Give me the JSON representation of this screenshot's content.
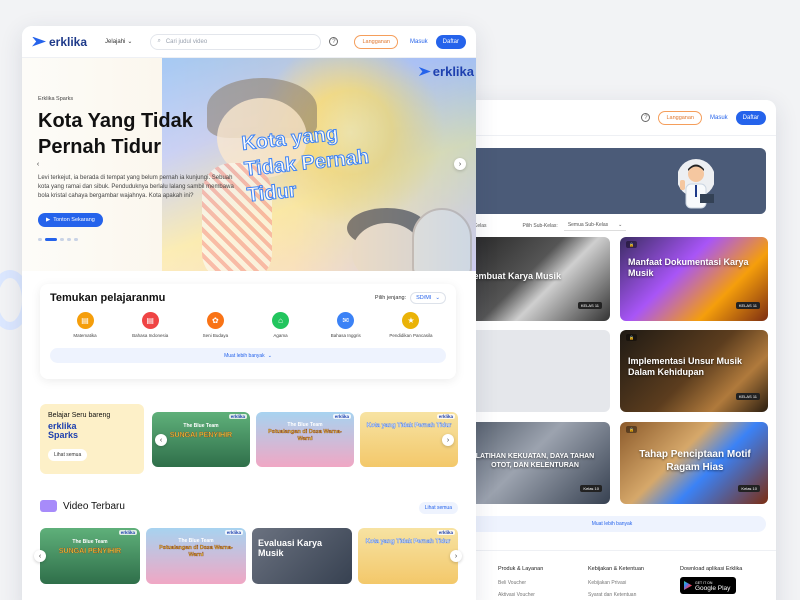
{
  "brand": "erklika",
  "back": {
    "nav": {
      "login": "Masuk",
      "register": "Daftar",
      "subscribe": "Langganan"
    },
    "filters": {
      "kelas": "Kelas",
      "subkelas_label": "Pilih Sub-Kelas:",
      "subkelas_value": "Semua Sub-Kelas"
    },
    "cards": [
      {
        "title": "Membuat Karya Musik",
        "kelas": "KELAS 11",
        "bg": "#3a3a3a"
      },
      {
        "title": "Manfaat Dokumentasi Karya Musik",
        "kelas": "KELAS 11",
        "bg": "#5b3a6e"
      },
      {
        "title": "",
        "kelas": "",
        "bg": "#e5e7eb"
      },
      {
        "title": "Implementasi Unsur Musik Dalam Kehidupan",
        "kelas": "KELAS 11",
        "bg": "#4a3320"
      },
      {
        "title": "LATIHAN KEKUATAN, DAYA TAHAN OTOT, DAN KELENTURAN",
        "kelas": "Kelas 10",
        "bg": "#3f4a5a"
      },
      {
        "title": "Tahap Penciptaan Motif Ragam Hias",
        "kelas": "Kelas 10",
        "bg": "#6b4a2e"
      }
    ],
    "more": "Muat lebih banyak",
    "footer": {
      "col1": {
        "title": "Produk & Layanan",
        "links": [
          "Beli Voucher",
          "Aktivasi Voucher"
        ]
      },
      "col2": {
        "title": "Kebijakan & Ketentuan",
        "links": [
          "Kebijakan Privasi",
          "Syarat dan Ketentuan"
        ]
      },
      "col3": {
        "title": "Download aplikasi Erklika",
        "badge_small": "GET IT ON",
        "badge": "Google Play"
      }
    }
  },
  "front": {
    "nav": {
      "explore": "Jelajahi",
      "search_placeholder": "Cari judul video",
      "subscribe": "Langganan",
      "login": "Masuk",
      "register": "Daftar"
    },
    "hero": {
      "eyebrow": "Erklika Sparks",
      "title": "Kota Yang Tidak Pernah Tidur",
      "desc": "Levi terkejut, ia berada di tempat yang belum pernah ia kunjungi. Sebuah kota yang ramai dan sibuk. Penduduknya berlalu lalang sambil membawa bola kristal cahaya bergambar wajahnya. Kota apakah ini?",
      "cta": "Tonton Sekarang",
      "watermark": "Kota yang Tidak Pernah Tidur",
      "logo": "erklika"
    },
    "subjects": {
      "title": "Temukan pelajaranmu",
      "level_label": "Pilih jenjang:",
      "level_value": "SD/MI",
      "items": [
        {
          "label": "Matematika",
          "color": "#f59e0b",
          "icon": "📗"
        },
        {
          "label": "Bahasa Indonesia",
          "color": "#ef4444",
          "icon": "📕"
        },
        {
          "label": "Seni Budaya",
          "color": "#f97316",
          "icon": "✿"
        },
        {
          "label": "Agama",
          "color": "#22c55e",
          "icon": "⌂"
        },
        {
          "label": "Bahasa Inggris",
          "color": "#3b82f6",
          "icon": "✉"
        },
        {
          "label": "Pendidikan Pancasila",
          "color": "#eab308",
          "icon": "★"
        }
      ],
      "more": "Muat lebih banyak"
    },
    "sparks": {
      "line1": "Belajar Seru bareng",
      "brand1": "erklika",
      "brand2": "Sparks",
      "button": "Lihat semua"
    },
    "series": [
      {
        "title": "SUNGAI PENYIHIR",
        "sub": "The Blue Team",
        "bg": "#4d9a6a"
      },
      {
        "title": "Petualangan di Desa Warna-Warni",
        "sub": "The Blue Team",
        "bg": "#9bc7e8"
      },
      {
        "title": "Kota yang Tidak Pernah Tidur",
        "sub": "",
        "bg": "#f3d98a"
      }
    ],
    "videos": {
      "title": "Video Terbaru",
      "see_all": "Lihat semua",
      "items": [
        {
          "title": "SUNGAI PENYIHIR",
          "sub": "The Blue Team",
          "bg": "#4d9a6a"
        },
        {
          "title": "Petualangan di Desa Warna-Warni",
          "sub": "The Blue Team",
          "bg": "#9bc7e8"
        },
        {
          "title": "Evaluasi Karya Musik",
          "sub": "",
          "bg": "#5a5f6b"
        },
        {
          "title": "Kota yang Tidak Pernah Tidur",
          "sub": "",
          "bg": "#f3d98a"
        }
      ]
    }
  }
}
